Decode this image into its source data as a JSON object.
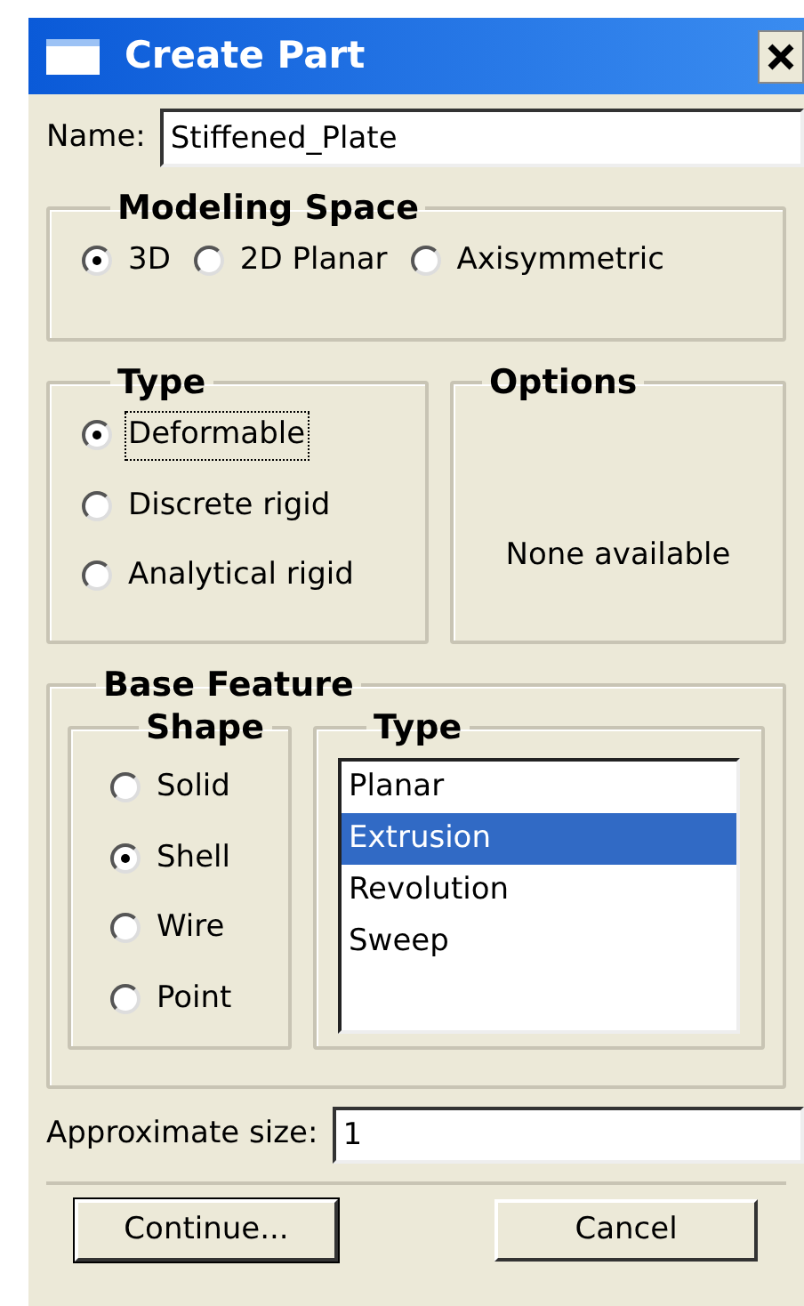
{
  "window": {
    "title": "Create Part"
  },
  "name_field": {
    "label": "Name:",
    "value": "Stiffened_Plate"
  },
  "modeling_space": {
    "title": "Modeling Space",
    "options": [
      {
        "label": "3D",
        "selected": true
      },
      {
        "label": "2D Planar",
        "selected": false
      },
      {
        "label": "Axisymmetric",
        "selected": false
      }
    ]
  },
  "type": {
    "title": "Type",
    "options": [
      {
        "label": "Deformable",
        "selected": true,
        "focused": true
      },
      {
        "label": "Discrete rigid",
        "selected": false,
        "focused": false
      },
      {
        "label": "Analytical rigid",
        "selected": false,
        "focused": false
      }
    ]
  },
  "options": {
    "title": "Options",
    "message": "None available"
  },
  "base_feature": {
    "title": "Base Feature",
    "shape": {
      "title": "Shape",
      "options": [
        {
          "label": "Solid",
          "selected": false
        },
        {
          "label": "Shell",
          "selected": true
        },
        {
          "label": "Wire",
          "selected": false
        },
        {
          "label": "Point",
          "selected": false
        }
      ]
    },
    "type": {
      "title": "Type",
      "items": [
        {
          "label": "Planar",
          "selected": false
        },
        {
          "label": "Extrusion",
          "selected": true
        },
        {
          "label": "Revolution",
          "selected": false
        },
        {
          "label": "Sweep",
          "selected": false
        }
      ]
    }
  },
  "approximate_size": {
    "label": "Approximate size:",
    "value": "1"
  },
  "buttons": [
    "Continue...",
    "Cancel"
  ]
}
